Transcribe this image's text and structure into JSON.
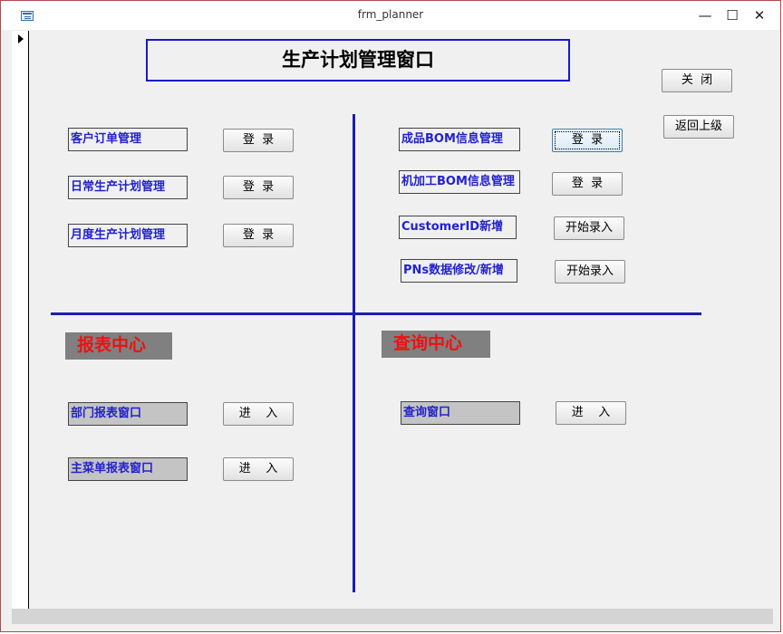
{
  "window": {
    "title": "frm_planner",
    "controls": {
      "minimize": "—",
      "maximize": "☐",
      "close": "✕"
    }
  },
  "header": {
    "title": "生产计划管理窗口"
  },
  "top_buttons": {
    "close_label": "关  闭",
    "back_label": "返回上级"
  },
  "left_section": {
    "items": [
      {
        "label": "客户订单管理",
        "button": "登  录"
      },
      {
        "label": "日常生产计划管理",
        "button": "登  录"
      },
      {
        "label": "月度生产计划管理",
        "button": "登  录"
      }
    ]
  },
  "right_section": {
    "items": [
      {
        "label": "成品BOM信息管理",
        "button": "登  录"
      },
      {
        "label": "机加工BOM信息管理",
        "button": "登  录"
      },
      {
        "label": "CustomerID新增",
        "button": "开始录入"
      },
      {
        "label": "PNs数据修改/新增",
        "button": "开始录入"
      }
    ]
  },
  "report_center": {
    "title": "报表中心",
    "items": [
      {
        "label": "部门报表窗口",
        "button": "进    入"
      },
      {
        "label": "主菜单报表窗口",
        "button": "进    入"
      }
    ]
  },
  "query_center": {
    "title": "查询中心",
    "items": [
      {
        "label": "查询窗口",
        "button": "进    入"
      }
    ]
  },
  "colors": {
    "label_text": "#2222cc",
    "divider": "#1c1cb8",
    "section_title_text": "#ee1111",
    "section_title_bg": "#808080"
  }
}
